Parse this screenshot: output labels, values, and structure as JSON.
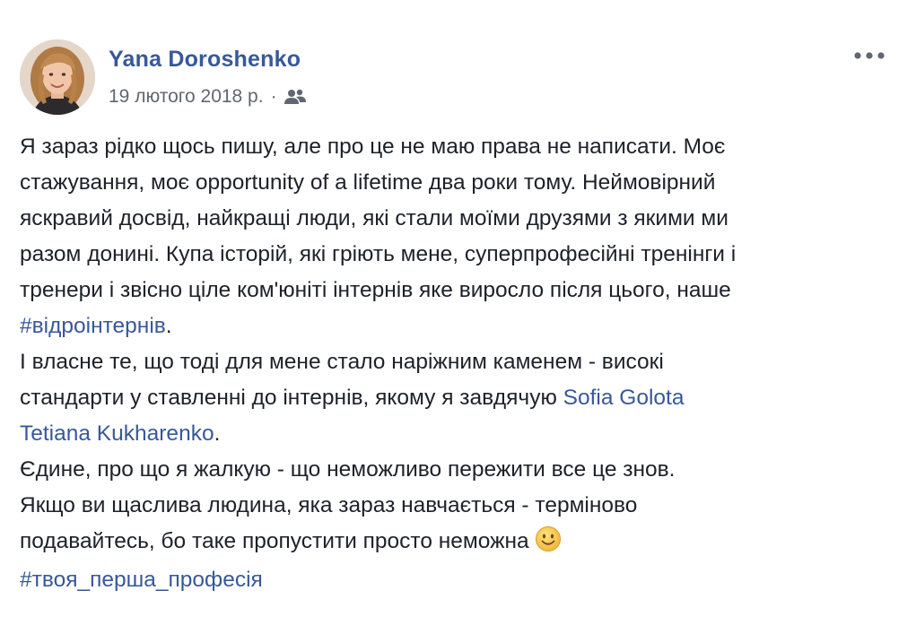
{
  "post": {
    "author": "Yana Doroshenko",
    "date": "19 лютого 2018 р.",
    "separator": "·",
    "audience_icon": "friends-icon",
    "more_icon": "more-options-icon",
    "paragraph1": {
      "line1": "Я зараз рідко щось пишу, але про це не маю права не написати. Моє",
      "line2": "стажування, моє opportunity of a lifetime два роки тому. Неймовірний",
      "line3": "яскравий досвід, найкращі люди, які стали моїми друзями з якими ми",
      "line4": "разом донині. Купа історій, які гріють мене, суперпрофесійні тренінги і",
      "line5": "тренери і звісно ціле ком'юніті інтернів яке виросло після цього, наше",
      "hashtag": "#відроінтернів",
      "hashtag_suffix": "."
    },
    "paragraph2": {
      "line1": "І власне те, що тоді для мене стало наріжним каменем - високі",
      "line2_text": "стандарти у ставленні до інтернів, якому я завдячую ",
      "mention1": "Sofia Golota",
      "mention2": "Tetiana Kukharenko",
      "mention2_suffix": "."
    },
    "paragraph3": {
      "line1": "Єдине, про що я жалкую - що неможливо пережити все це знов.",
      "line2": "Якщо ви щаслива людина, яка зараз навчається - терміново",
      "line3": "подавайтесь, бо таке пропустити просто неможна",
      "emoji": "smile-emoji"
    },
    "hashtag_bottom": "#твоя_перша_професія"
  },
  "colors": {
    "link": "#385898",
    "text": "#1d2129",
    "meta": "#616770",
    "emoji": "#f7c94b"
  }
}
